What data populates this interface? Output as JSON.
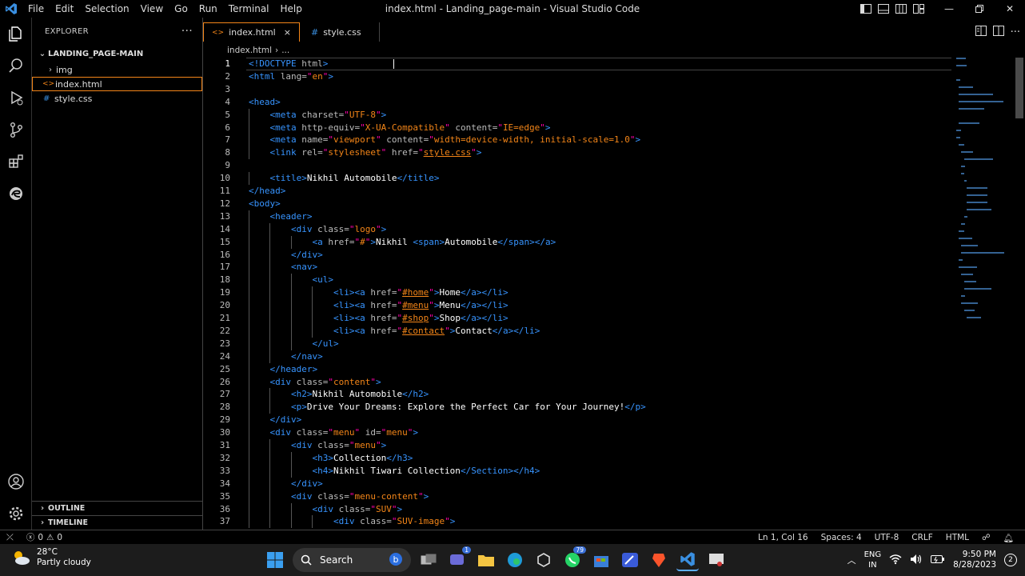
{
  "titlebar": {
    "menu": [
      "File",
      "Edit",
      "Selection",
      "View",
      "Go",
      "Run",
      "Terminal",
      "Help"
    ],
    "title": "index.html - Landing_page-main - Visual Studio Code"
  },
  "sidebar": {
    "header": "EXPLORER",
    "more": "···",
    "folder": "LANDING_PAGE-MAIN",
    "items": [
      {
        "label": "img",
        "type": "folder"
      },
      {
        "label": "index.html",
        "type": "html"
      },
      {
        "label": "style.css",
        "type": "css"
      }
    ],
    "sections": [
      "OUTLINE",
      "TIMELINE"
    ]
  },
  "tabs": [
    {
      "label": "index.html",
      "icon": "<>",
      "close": "×"
    },
    {
      "label": "style.css",
      "icon": "#"
    }
  ],
  "breadcrumb": {
    "file": "index.html",
    "sep": "›",
    "rest": "..."
  },
  "editor": {
    "lines": [
      "<!DOCTYPE html>",
      "<html lang=\"en\">",
      "",
      "<head>",
      "    <meta charset=\"UTF-8\">",
      "    <meta http-equiv=\"X-UA-Compatible\" content=\"IE=edge\">",
      "    <meta name=\"viewport\" content=\"width=device-width, initial-scale=1.0\">",
      "    <link rel=\"stylesheet\" href=\"style.css\">",
      "",
      "    <title>Nikhil Automobile</title>",
      "</head>",
      "<body>",
      "    <header>",
      "        <div class=\"logo\">",
      "            <a href=\"#\">Nikhil <span>Automobile</span></a>",
      "        </div>",
      "        <nav>",
      "            <ul>",
      "                <li><a href=\"#home\">Home</a></li>",
      "                <li><a href=\"#menu\">Menu</a></li>",
      "                <li><a href=\"#shop\">Shop</a></li>",
      "                <li><a href=\"#contact\">Contact</a></li>",
      "            </ul>",
      "        </nav>",
      "    </header>",
      "    <div class=\"content\">",
      "        <h2>Nikhil Automobile</h2>",
      "        <p>Drive Your Dreams: Explore the Perfect Car for Your Journey!</p>",
      "    </div>",
      "    <div class=\"menu\" id=\"menu\">",
      "        <div class=\"menu\">",
      "            <h3>Collection</h3>",
      "            <h4>Nikhil Tiwari Collection</Section></h4>",
      "        </div>",
      "        <div class=\"menu-content\">",
      "            <div class=\"SUV\">",
      "                <div class=\"SUV-image\">"
    ]
  },
  "status": {
    "errors": "0",
    "warnings": "0",
    "position": "Ln 1, Col 16",
    "spaces": "Spaces: 4",
    "encoding": "UTF-8",
    "eol": "CRLF",
    "language": "HTML"
  },
  "taskbar": {
    "temp": "28°C",
    "weather": "Partly cloudy",
    "search": "Search",
    "teams_badge": "1",
    "whatsapp_badge": "79",
    "lang1": "ENG",
    "lang2": "IN",
    "time": "9:50 PM",
    "date": "8/28/2023",
    "notifications": "2"
  },
  "colors": {
    "tag": "#3794ff",
    "string": "#f0a",
    "accent": "#f38518"
  }
}
